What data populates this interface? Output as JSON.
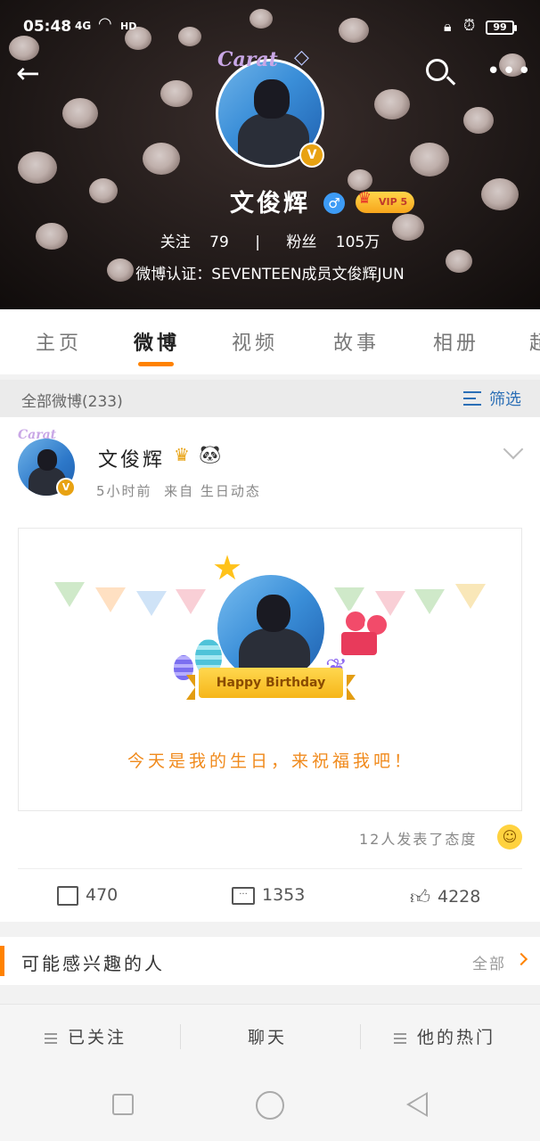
{
  "status_bar": {
    "time": "05:48",
    "signal": "4G",
    "network": "HD",
    "battery": "99"
  },
  "header": {
    "logo_text": "Carat",
    "name": "文俊辉",
    "vip_label": "VIP 5",
    "following_label": "关注",
    "following_count": "79",
    "separator": "|",
    "fans_label": "粉丝",
    "fans_count": "105万",
    "verification": "微博认证：SEVENTEEN成员文俊辉JUN"
  },
  "tabs": [
    {
      "label": "主页",
      "active": false
    },
    {
      "label": "微博",
      "active": true
    },
    {
      "label": "视频",
      "active": false
    },
    {
      "label": "故事",
      "active": false
    },
    {
      "label": "相册",
      "active": false
    },
    {
      "label": "超",
      "active": false
    }
  ],
  "filter": {
    "count_label": "全部微博(233)",
    "filter_label": "筛选"
  },
  "post": {
    "author": "文俊辉",
    "time": "5小时前",
    "source_prefix": "来自",
    "source": "生日动态",
    "card_banner": "Happy Birthday",
    "card_message": "今天是我的生日，来祝福我吧！",
    "reactions": "12人发表了态度",
    "reposts": "470",
    "comments": "1353",
    "likes": "4228"
  },
  "suggest": {
    "title": "可能感兴趣的人",
    "all_label": "全部"
  },
  "bottom_bar": {
    "followed": "已关注",
    "chat": "聊天",
    "hot": "他的热门"
  },
  "colors": {
    "accent": "#ff8200",
    "link_blue": "#2b6fb6",
    "vip_gold": "#f7a51c"
  }
}
